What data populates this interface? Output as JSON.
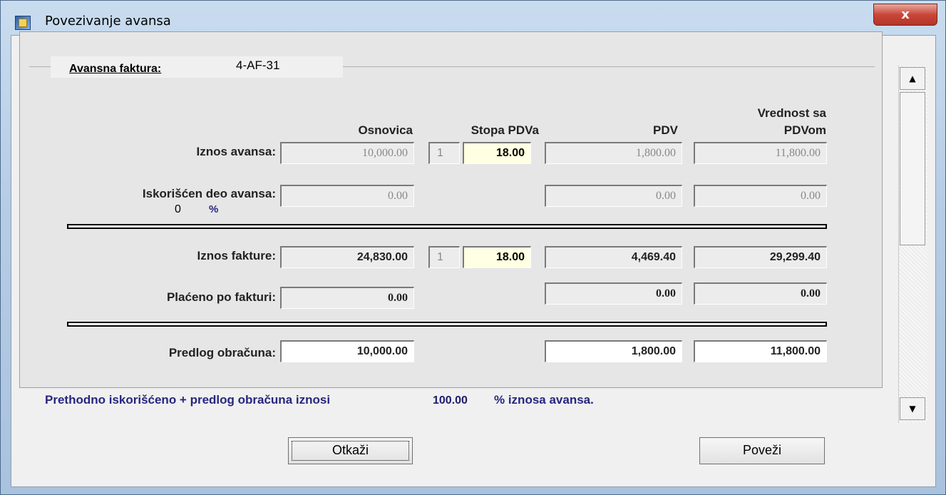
{
  "window": {
    "title": "Povezivanje avansa",
    "close_label": "x"
  },
  "group": {
    "label": "Avansna faktura:",
    "invoice_number": "4-AF-31"
  },
  "columns": {
    "osnovica": "Osnovica",
    "stopa_pdva": "Stopa PDVa",
    "pdv": "PDV",
    "vrednost_line1": "Vrednost sa",
    "vrednost_line2": "PDVom"
  },
  "rows": {
    "iznos_avansa": {
      "label": "Iznos avansa:",
      "osnovica": "10,000.00",
      "rate_code": "1",
      "rate": "18.00",
      "pdv": "1,800.00",
      "vrednost": "11,800.00"
    },
    "iskoriscen_deo": {
      "label": "Iskorišćen deo avansa:",
      "percent_value": "0",
      "percent_sign": "%",
      "osnovica": "0.00",
      "pdv": "0.00",
      "vrednost": "0.00"
    },
    "iznos_fakture": {
      "label": "Iznos fakture:",
      "osnovica": "24,830.00",
      "rate_code": "1",
      "rate": "18.00",
      "pdv": "4,469.40",
      "vrednost": "29,299.40"
    },
    "placeno": {
      "label": "Plaćeno po fakturi:",
      "osnovica": "0.00",
      "pdv": "0.00",
      "vrednost": "0.00"
    },
    "predlog": {
      "label": "Predlog obračuna:",
      "osnovica": "10,000.00",
      "pdv": "1,800.00",
      "vrednost": "11,800.00"
    }
  },
  "summary": {
    "prefix": "Prethodno iskorišćeno + predlog obračuna iznosi",
    "value": "100.00",
    "suffix": "%  iznosa avansa."
  },
  "buttons": {
    "cancel": "Otkaži",
    "connect": "Poveži"
  },
  "scrollbar": {
    "up_icon": "triangle-up",
    "down_icon": "triangle-down"
  }
}
